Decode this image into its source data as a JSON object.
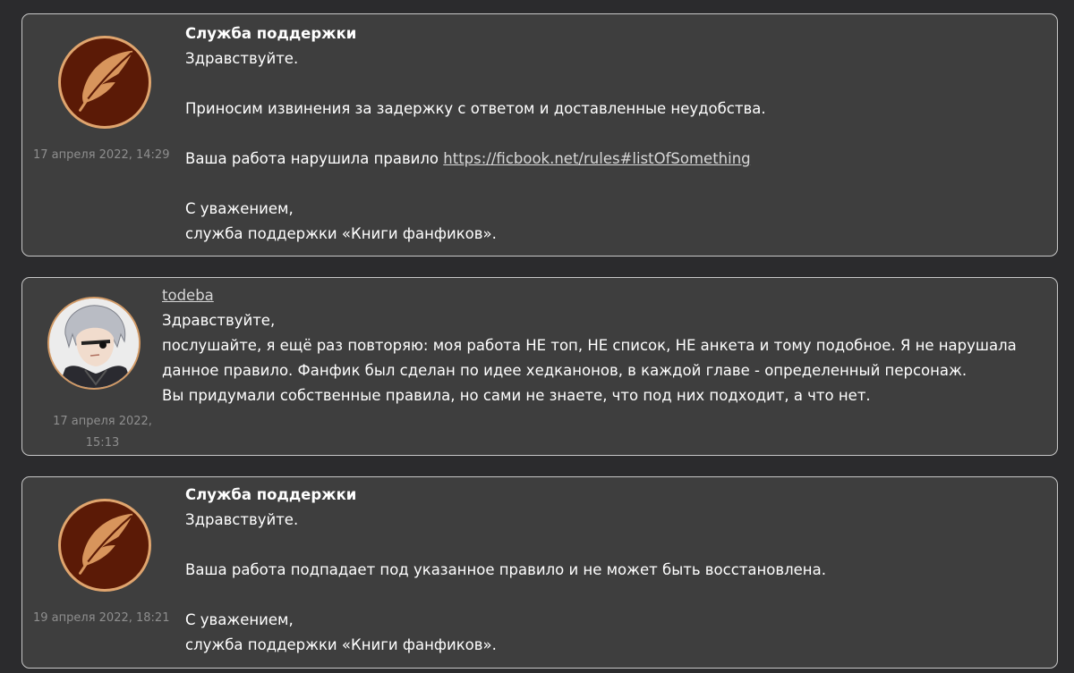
{
  "messages": [
    {
      "author": "Служба поддержки",
      "date": "17 апреля 2022, 14:29",
      "greeting": "Здравствуйте.",
      "line1": "Приносим извинения за задержку с ответом и доставленные неудобства.",
      "line2_prefix": "Ваша работа нарушила правило ",
      "link": "https://ficbook.net/rules#listOfSomething",
      "sign1": "С уважением,",
      "sign2": "служба поддержки «Книги фанфиков»."
    },
    {
      "author": "todeba",
      "date_line1": "17 апреля 2022,",
      "date_line2": "15:13",
      "greeting": "Здравствуйте,",
      "line1": "послушайте, я ещё раз повторяю: моя работа НЕ топ, НЕ список, НЕ анкета и тому подобное. Я не нарушала",
      "line2": "данное правило. Фанфик был сделан по идее хедканонов, в каждой главе - определенный персонаж.",
      "line3": "Вы придумали собственные правила, но сами не знаете, что под них подходит, а что нет."
    },
    {
      "author": "Служба поддержки",
      "date": "19 апреля 2022, 18:21",
      "greeting": "Здравствуйте.",
      "line1": "Ваша работа подпадает под указанное правило и не может быть восстановлена.",
      "sign1": "С уважением,",
      "sign2": "служба поддержки «Книги фанфиков»."
    }
  ],
  "icons": {
    "support_avatar": "quill-feather-icon",
    "user_avatar": "anime-character-avatar"
  },
  "colors": {
    "background": "#2b2b2d",
    "card": "#3e3e3e",
    "avatar_fill": "#5b1a06",
    "avatar_ring": "#e0a56e"
  }
}
